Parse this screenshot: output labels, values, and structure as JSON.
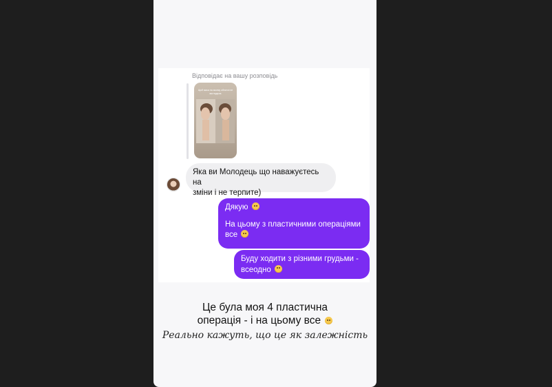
{
  "reply_context": {
    "label": "Відповідає на вашу розповідь",
    "story_thumbnail": {
      "caption": "Щоб маса на моєму обличчі не виглядала",
      "footer": ""
    }
  },
  "messages": [
    {
      "sender": "them",
      "line1": "Яка ви Молодець що наважуєтесь на",
      "line2": "зміни і не терпите)"
    },
    {
      "sender": "me",
      "line1": "Дякую",
      "line2": "На цьому з пластичними операціями",
      "line3": "все"
    },
    {
      "sender": "me",
      "line1": "Буду ходити з різними грудьми -",
      "line2": "всеодно"
    }
  ],
  "story_caption": {
    "line1": "Це була моя 4 пластична",
    "line2": "операція - і на цьому все",
    "italic": "Реально кажуть, що це як залежність"
  },
  "icons": {
    "pleading": "pleading-face-emoji",
    "grimace": "grimacing-face-emoji",
    "laugh": "grinning-sweat-emoji"
  },
  "colors": {
    "outgoing_bubble": "#7b2cf2",
    "incoming_bubble": "#efeff1",
    "background": "#1e1e1e"
  }
}
